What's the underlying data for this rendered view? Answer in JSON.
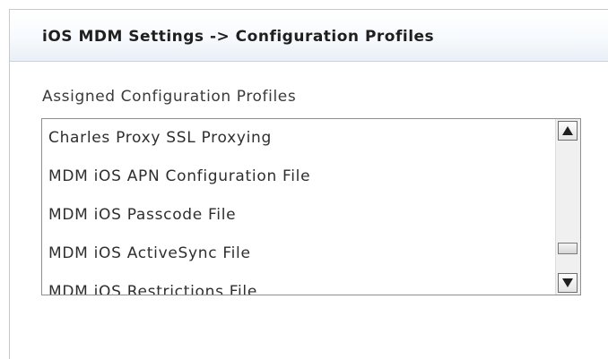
{
  "panel": {
    "title": "iOS MDM Settings -> Configuration Profiles"
  },
  "profiles": {
    "label": "Assigned Configuration Profiles",
    "items": [
      "Charles Proxy SSL Proxying",
      "MDM iOS APN Configuration File",
      "MDM iOS Passcode File",
      "MDM iOS ActiveSync File",
      "MDM iOS Restrictions File"
    ],
    "scroll_position_fraction": 0.85
  },
  "icons": {
    "scroll_up": "triangle-up-icon",
    "scroll_down": "triangle-down-icon"
  },
  "colors": {
    "header_gradient_bottom": "#e9eff6",
    "text": "#2e2e2e",
    "border": "#8f8f8f"
  }
}
